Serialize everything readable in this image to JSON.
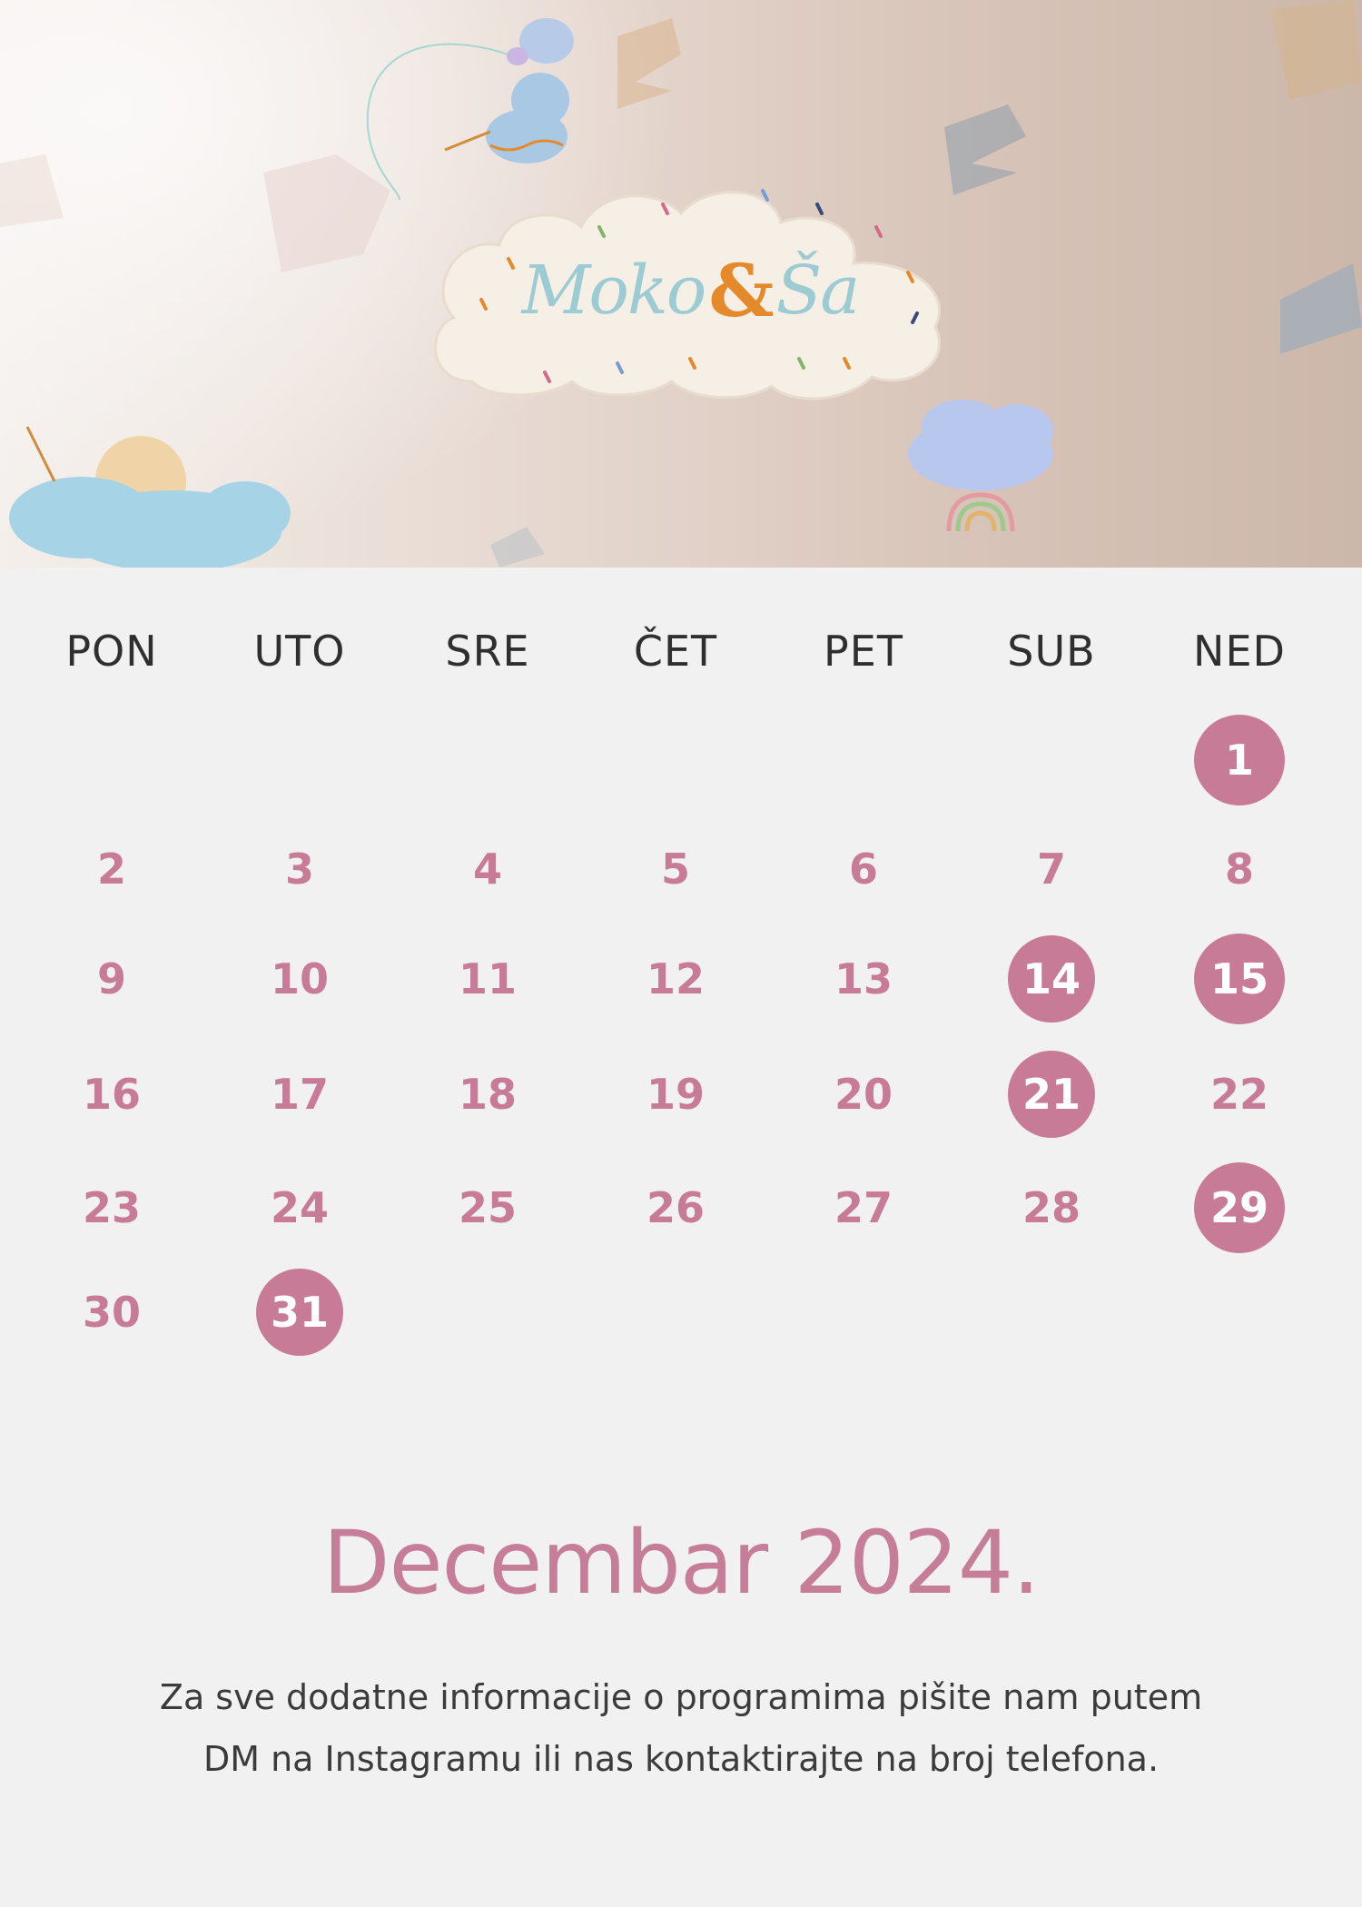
{
  "hero": {
    "logo": {
      "part1": "Moko",
      "amp": "&",
      "part2": "Ša"
    }
  },
  "calendar": {
    "weekdays": [
      "PON",
      "UTO",
      "SRE",
      "ČET",
      "PET",
      "SUB",
      "NED"
    ],
    "days": [
      {
        "n": "1",
        "hl": true
      },
      {
        "n": "2",
        "hl": false
      },
      {
        "n": "3",
        "hl": false
      },
      {
        "n": "4",
        "hl": false
      },
      {
        "n": "5",
        "hl": false
      },
      {
        "n": "6",
        "hl": false
      },
      {
        "n": "7",
        "hl": false
      },
      {
        "n": "8",
        "hl": false
      },
      {
        "n": "9",
        "hl": false
      },
      {
        "n": "10",
        "hl": false
      },
      {
        "n": "11",
        "hl": false
      },
      {
        "n": "12",
        "hl": false
      },
      {
        "n": "13",
        "hl": false
      },
      {
        "n": "14",
        "hl": true
      },
      {
        "n": "15",
        "hl": true
      },
      {
        "n": "16",
        "hl": false
      },
      {
        "n": "17",
        "hl": false
      },
      {
        "n": "18",
        "hl": false
      },
      {
        "n": "19",
        "hl": false
      },
      {
        "n": "20",
        "hl": false
      },
      {
        "n": "21",
        "hl": true
      },
      {
        "n": "22",
        "hl": false
      },
      {
        "n": "23",
        "hl": false
      },
      {
        "n": "24",
        "hl": false
      },
      {
        "n": "25",
        "hl": false
      },
      {
        "n": "26",
        "hl": false
      },
      {
        "n": "27",
        "hl": false
      },
      {
        "n": "28",
        "hl": false
      },
      {
        "n": "29",
        "hl": true
      },
      {
        "n": "30",
        "hl": false
      },
      {
        "n": "31",
        "hl": true
      }
    ],
    "start_weekday_index": 6
  },
  "footer": {
    "month_title": "Decembar 2024.",
    "info_line1": "Za sve dodatne informacije o programima pišite nam putem",
    "info_line2": "DM na Instagramu ili nas kontaktirajte na broj telefona."
  },
  "colors": {
    "accent": "#c87b97",
    "text": "#2f2f2f",
    "background": "#f1f1f1"
  }
}
